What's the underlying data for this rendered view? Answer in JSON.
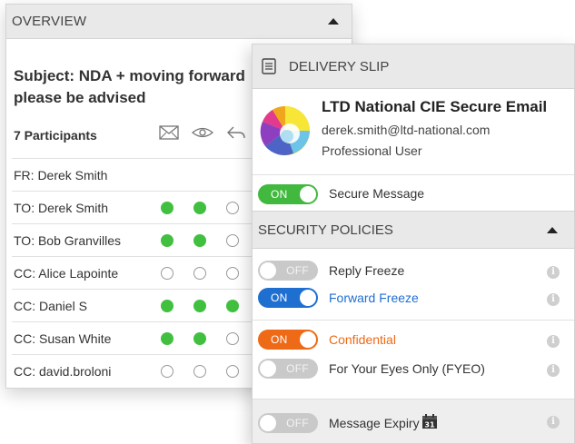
{
  "overview": {
    "title": "OVERVIEW",
    "subject": "Subject: NDA + moving forward please be advised",
    "participants_label": "7 Participants",
    "column_icons": [
      "envelope-icon",
      "eye-icon",
      "reply-icon"
    ],
    "participants": [
      {
        "role": "FR:",
        "name": "Derek Smith",
        "status": null
      },
      {
        "role": "TO:",
        "name": "Derek Smith",
        "status": [
          true,
          true,
          false
        ]
      },
      {
        "role": "TO:",
        "name": "Bob Granvilles",
        "status": [
          true,
          true,
          false
        ]
      },
      {
        "role": "CC:",
        "name": "Alice Lapointe",
        "status": [
          false,
          false,
          false
        ]
      },
      {
        "role": "CC:",
        "name": "Daniel S",
        "status": [
          true,
          true,
          true
        ]
      },
      {
        "role": "CC:",
        "name": "Susan White",
        "status": [
          true,
          true,
          false
        ]
      },
      {
        "role": "CC:",
        "name": "david.broloni",
        "status": [
          false,
          false,
          false
        ]
      }
    ],
    "row_texts": [
      "FR:  Derek Smith",
      "TO:  Derek Smith",
      "TO:  Bob Granvilles",
      "CC:  Alice Lapointe",
      "CC:  Daniel S",
      "CC:  Susan White",
      "CC:  david.broloni"
    ]
  },
  "slip": {
    "title": "DELIVERY SLIP",
    "sender": {
      "name": "LTD National CIE Secure Email",
      "email": "derek.smith@ltd-national.com",
      "role": "Professional User"
    },
    "secure_message": {
      "state": "ON",
      "label": "Secure Message"
    },
    "policies_title": "SECURITY POLICIES",
    "policies": [
      {
        "state": "OFF",
        "label": "Reply Freeze",
        "color": "#c9c9c9"
      },
      {
        "state": "ON",
        "label": "Forward Freeze",
        "color": "#1f6fd1"
      },
      {
        "state": "ON",
        "label": "Confidential",
        "color": "#ee6a16"
      },
      {
        "state": "OFF",
        "label": "For Your Eyes Only (FYEO)",
        "color": "#c9c9c9"
      },
      {
        "state": "OFF",
        "label": "Message Expiry",
        "color": "#c9c9c9"
      }
    ],
    "calendar_day": "31"
  },
  "colors": {
    "accent_green": "#41b83e",
    "accent_blue": "#1f6fd1",
    "accent_orange": "#ee6a16",
    "header_bg": "#e9e9e9"
  }
}
